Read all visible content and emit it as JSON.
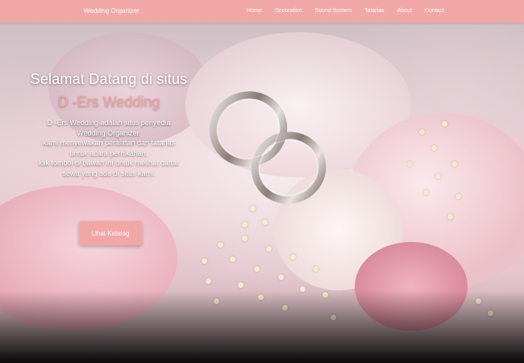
{
  "navbar": {
    "brand": "Wedding Organizer",
    "links": [
      {
        "label": "Home"
      },
      {
        "label": "Decoration"
      },
      {
        "label": "Sound System"
      },
      {
        "label": "Tatarias"
      },
      {
        "label": "About"
      },
      {
        "label": "Contact"
      }
    ],
    "background_color": "#f2a7a7"
  },
  "hero": {
    "title": "Selamat Datang di situs",
    "brand_name": "D -Ers Wedding",
    "description_lines": [
      "D -Ers Wedding adalah situs penyedia",
      "Wedding Organizer.",
      "kami menyewakan peralatan dan tatarias",
      "untuk acara pernikahan,",
      "klik tombol di bawah ini untuk melihat daftar",
      "sewa yang ada di situs kami."
    ],
    "button_label": "Lihat Katalog",
    "accent_color": "#f0a3a3"
  }
}
